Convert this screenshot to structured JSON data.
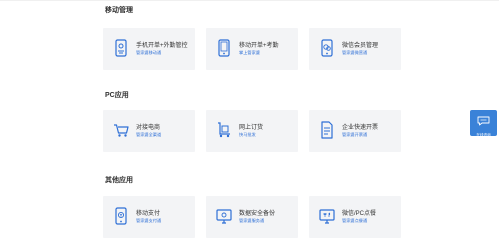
{
  "sections": [
    {
      "title": "移动管理",
      "cards": [
        {
          "title": "手机开单+外勤管控",
          "subtitle": "管家婆移动通",
          "icon": "phone-id-icon"
        },
        {
          "title": "移动开单+考勤",
          "subtitle": "掌上管家婆",
          "icon": "phone-icon"
        },
        {
          "title": "微信会员管理",
          "subtitle": "管家婆微营通",
          "icon": "phone-wechat-icon"
        }
      ]
    },
    {
      "title": "PC应用",
      "cards": [
        {
          "title": "对接电商",
          "subtitle": "管家婆全渠道",
          "icon": "cart-icon"
        },
        {
          "title": "网上订货",
          "subtitle": "快马批发",
          "icon": "handcart-icon"
        },
        {
          "title": "企业快速开票",
          "subtitle": "管家婆开票通",
          "icon": "invoice-icon"
        }
      ]
    },
    {
      "title": "其他应用",
      "cards": [
        {
          "title": "移动支付",
          "subtitle": "管家婆支付通",
          "icon": "mobile-pay-icon"
        },
        {
          "title": "数据安全备份",
          "subtitle": "管家婆服务通",
          "icon": "monitor-icon"
        },
        {
          "title": "微信/PC点餐",
          "subtitle": "管家婆点餐通",
          "icon": "dining-icon"
        }
      ]
    }
  ],
  "float_widget": {
    "label": "在线咨询",
    "icon": "chat-bubble-icon"
  },
  "colors": {
    "accent": "#2e6fd6",
    "card_bg": "#f3f4f6",
    "widget_bg": "#3a82d8"
  }
}
